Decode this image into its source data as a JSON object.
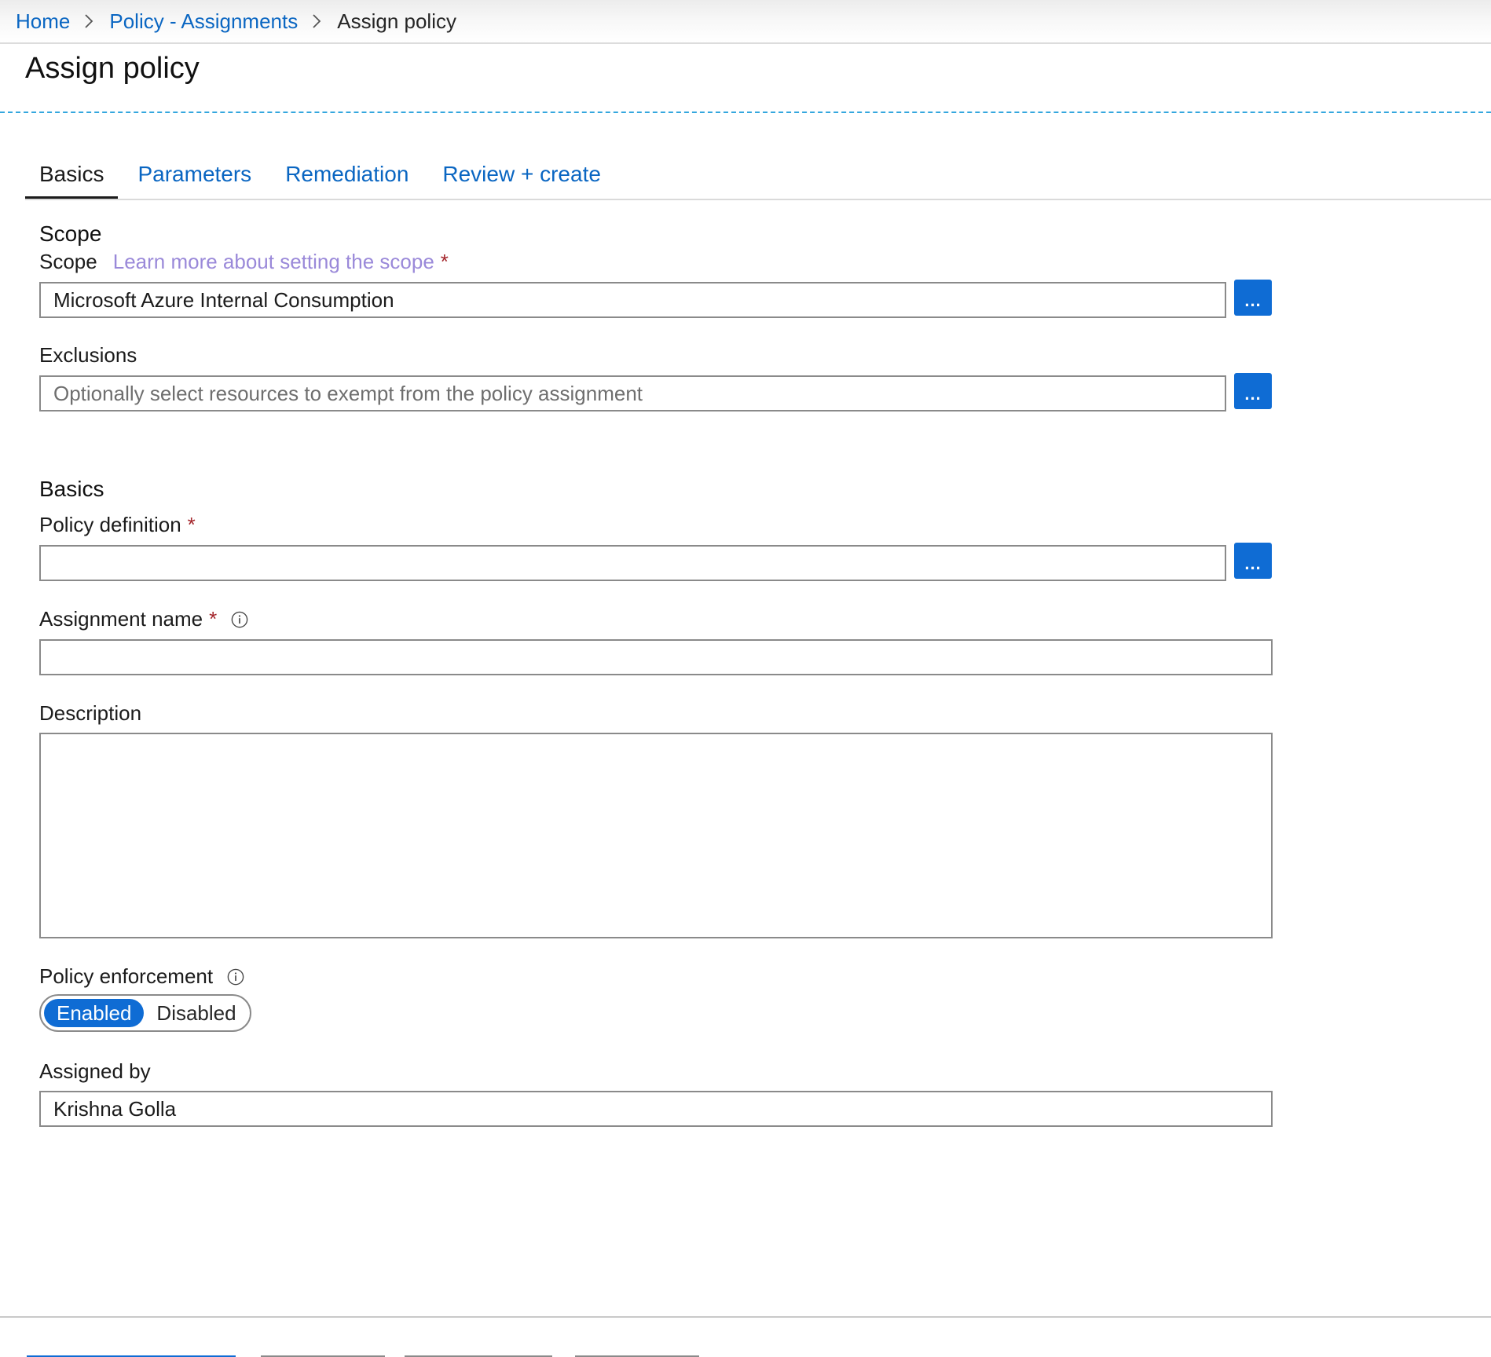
{
  "breadcrumb": {
    "home": "Home",
    "policy_assignments": "Policy - Assignments",
    "current": "Assign policy"
  },
  "page_title": "Assign policy",
  "tabs": [
    {
      "label": "Basics",
      "active": true
    },
    {
      "label": "Parameters",
      "active": false
    },
    {
      "label": "Remediation",
      "active": false
    },
    {
      "label": "Review + create",
      "active": false
    }
  ],
  "scope_section": {
    "heading": "Scope",
    "scope_label": "Scope",
    "learn_more_link": "Learn more about setting the scope",
    "required_mark": "*",
    "scope_value": "Microsoft Azure Internal Consumption",
    "exclusions_label": "Exclusions",
    "exclusions_placeholder": "Optionally select resources to exempt from the policy assignment",
    "browse_button": "..."
  },
  "basics_section": {
    "heading": "Basics",
    "policy_definition_label": "Policy definition",
    "policy_definition_value": "",
    "assignment_name_label": "Assignment name",
    "assignment_name_value": "",
    "description_label": "Description",
    "description_value": "",
    "policy_enforcement_label": "Policy enforcement",
    "enforcement_options": {
      "enabled": "Enabled",
      "disabled": "Disabled",
      "selected": "Enabled"
    },
    "assigned_by_label": "Assigned by",
    "assigned_by_value": "Krishna Golla"
  },
  "colors": {
    "link": "#0a66c2",
    "accent_button": "#0f6cd4",
    "learn_more_link": "#9a89d9",
    "required": "#a4262c",
    "dash_line": "#34a7de"
  },
  "icons": [
    "chevron-right-icon",
    "info-icon"
  ]
}
